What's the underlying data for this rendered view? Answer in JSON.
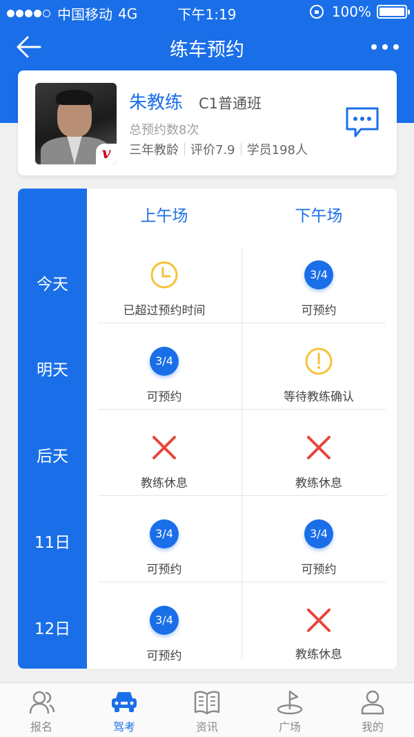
{
  "status_bar": {
    "carrier": "中国移动",
    "network": "4G",
    "time": "下午1:19",
    "battery": "100%"
  },
  "nav": {
    "title": "练车预约"
  },
  "coach": {
    "name": "朱教练",
    "class": "C1普通班",
    "total": "总预约数8次",
    "years": "三年教龄",
    "rating": "评价7.9",
    "students": "学员198人",
    "badge": "v"
  },
  "schedule": {
    "header_am": "上午场",
    "header_pm": "下午场",
    "days": [
      "今天",
      "明天",
      "后天",
      "11日",
      "12日"
    ],
    "rows": [
      {
        "am": {
          "icon": "clock-icon",
          "badge": "",
          "text": "已超过预约时间"
        },
        "pm": {
          "icon": "available-badge",
          "badge": "3/4",
          "text": "可预约"
        }
      },
      {
        "am": {
          "icon": "available-badge",
          "badge": "3/4",
          "text": "可预约"
        },
        "pm": {
          "icon": "warning-icon",
          "badge": "",
          "text": "等待教练确认"
        }
      },
      {
        "am": {
          "icon": "close-icon",
          "badge": "",
          "text": "教练休息"
        },
        "pm": {
          "icon": "close-icon",
          "badge": "",
          "text": "教练休息"
        }
      },
      {
        "am": {
          "icon": "available-badge",
          "badge": "3/4",
          "text": "可预约"
        },
        "pm": {
          "icon": "available-badge",
          "badge": "3/4",
          "text": "可预约"
        }
      },
      {
        "am": {
          "icon": "available-badge",
          "badge": "3/4",
          "text": "可预约"
        },
        "pm": {
          "icon": "close-icon",
          "badge": "",
          "text": "教练休息"
        }
      }
    ]
  },
  "tabs": [
    {
      "label": "报名",
      "icon": "users-icon",
      "active": false
    },
    {
      "label": "驾考",
      "icon": "car-icon",
      "active": true
    },
    {
      "label": "资讯",
      "icon": "book-icon",
      "active": false
    },
    {
      "label": "广场",
      "icon": "flag-icon",
      "active": false
    },
    {
      "label": "我的",
      "icon": "profile-icon",
      "active": false
    }
  ],
  "colors": {
    "primary": "#1a6fe8",
    "warning": "#f5c237",
    "danger": "#e8453c"
  }
}
